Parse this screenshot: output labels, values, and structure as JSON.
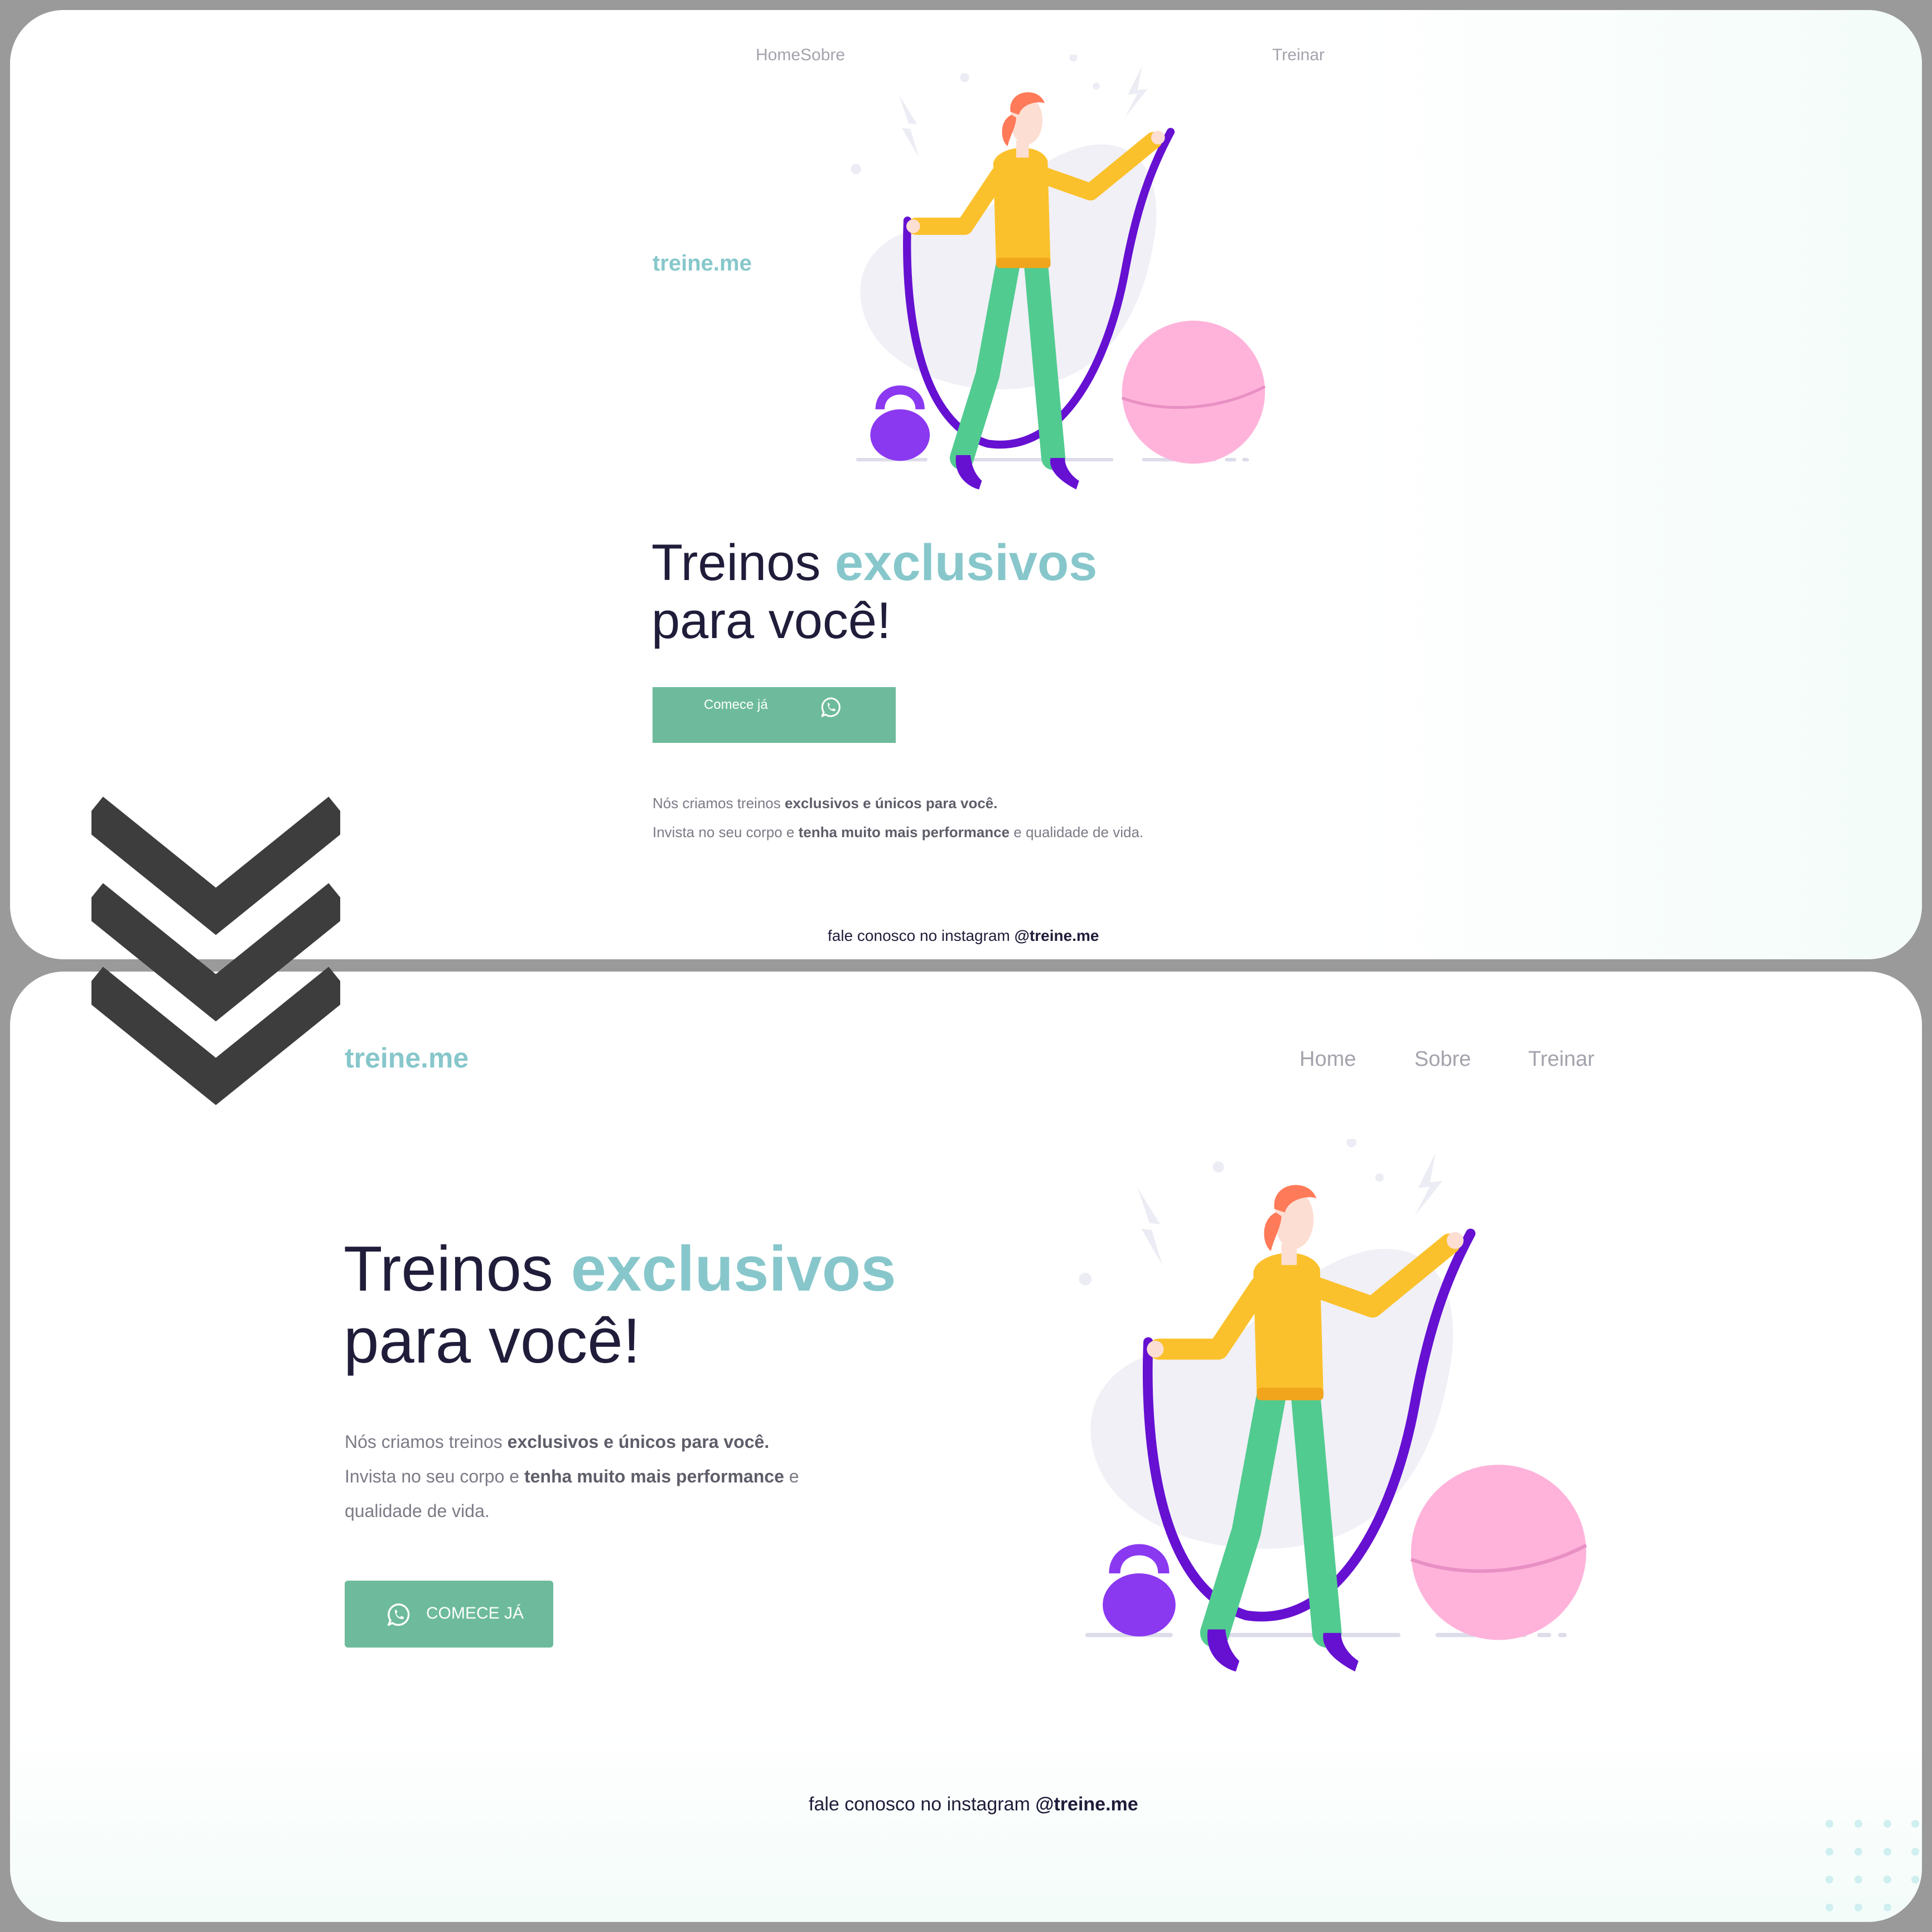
{
  "top_panel": {
    "nav": {
      "home_sobre": "HomeSobre",
      "treinar": "Treinar"
    },
    "logo": "treine.me",
    "headline": {
      "part1": "Treinos ",
      "accent": "exclusivos",
      "line2": "para você!"
    },
    "cta_label": "Comece já",
    "description": {
      "line1_plain": "Nós criamos treinos ",
      "line1_bold": "exclusivos e únicos para você.",
      "line2_plain_a": "Invista no seu corpo e ",
      "line2_bold": "tenha muito mais performance",
      "line2_plain_b": " e qualidade de vida."
    },
    "footer": {
      "text": "fale conosco no instagram ",
      "handle": "@treine.me"
    }
  },
  "bottom_panel": {
    "logo": "treine.me",
    "nav": {
      "home": "Home",
      "sobre": "Sobre",
      "treinar": "Treinar"
    },
    "headline": {
      "part1": "Treinos ",
      "accent": "exclusivos",
      "line2": "para você!"
    },
    "description": {
      "line1_plain": "Nós criamos treinos ",
      "line1_bold": "exclusivos e únicos para você.",
      "line2_plain_a": "Invista no seu corpo e ",
      "line2_bold": "tenha muito mais performance",
      "line2_plain_b": " e",
      "line3": "qualidade de vida."
    },
    "cta_label": "COMECE JÁ",
    "footer": {
      "text": "fale conosco no instagram ",
      "handle": "@treine.me"
    }
  },
  "icons": [
    "whatsapp-icon",
    "triple-chevron-down-icon",
    "fitness-illustration"
  ],
  "colors": {
    "accent": "#87c7cb",
    "button": "#6dbb9c",
    "dark_text": "#1f1d3a",
    "muted_text": "#7b7b86",
    "rope": "#6610d2",
    "shirt": "#fbc12c",
    "pants": "#52cb90",
    "ball": "#ffb3da"
  }
}
